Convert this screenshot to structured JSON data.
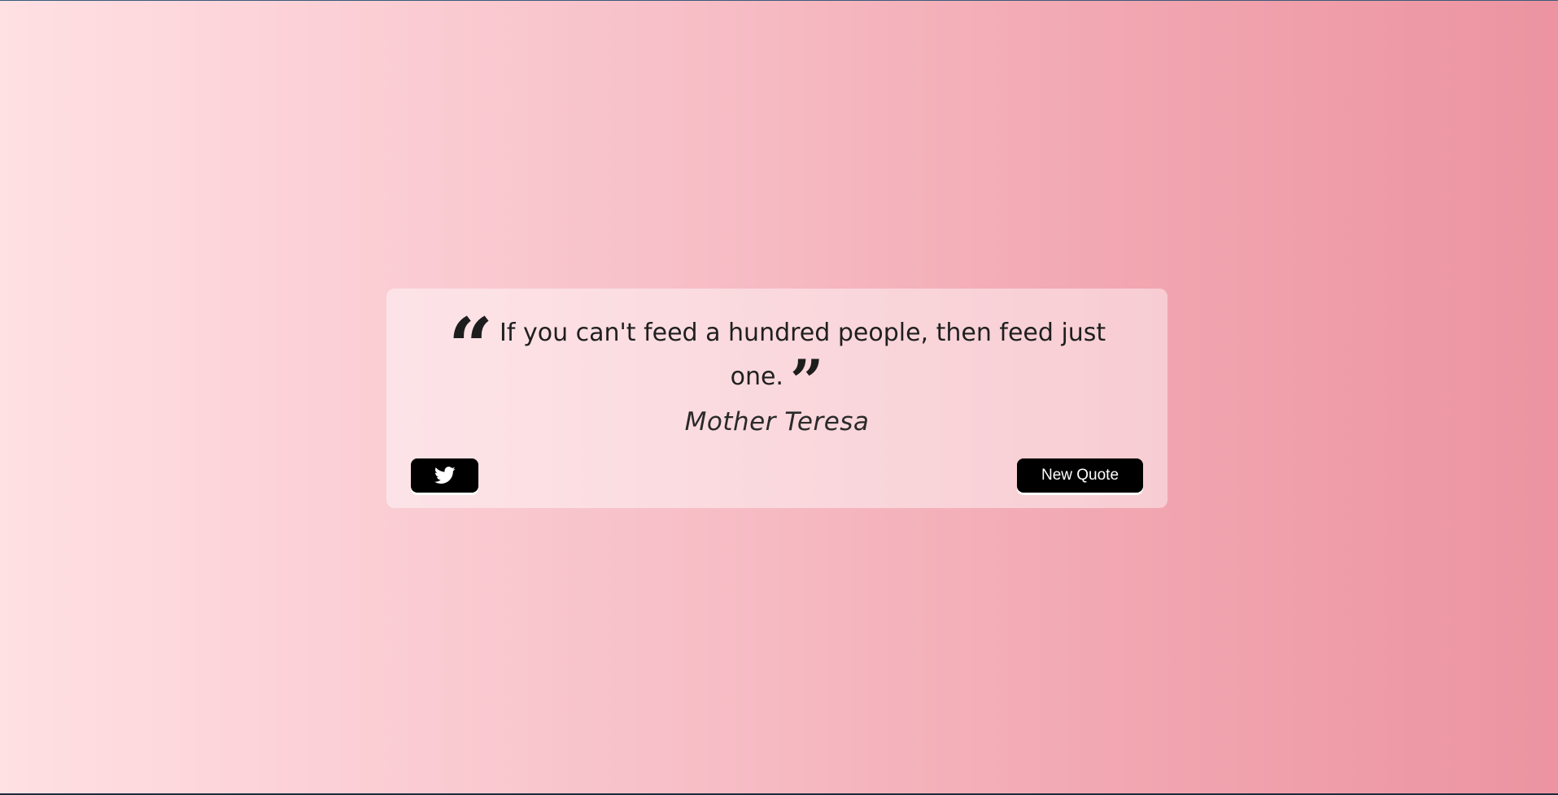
{
  "quote": {
    "text": "If you can't feed a hundred people, then feed just one.",
    "open_mark": "“",
    "close_mark": "”",
    "author": "Mother Teresa"
  },
  "actions": {
    "twitter_icon": "twitter-icon",
    "new_quote_label": "New Quote"
  },
  "colors": {
    "background_start": "#ffe0e3",
    "background_end": "#ec94a1",
    "button": "#000000",
    "button_text": "#ffffff",
    "text": "#1f1f1f"
  }
}
